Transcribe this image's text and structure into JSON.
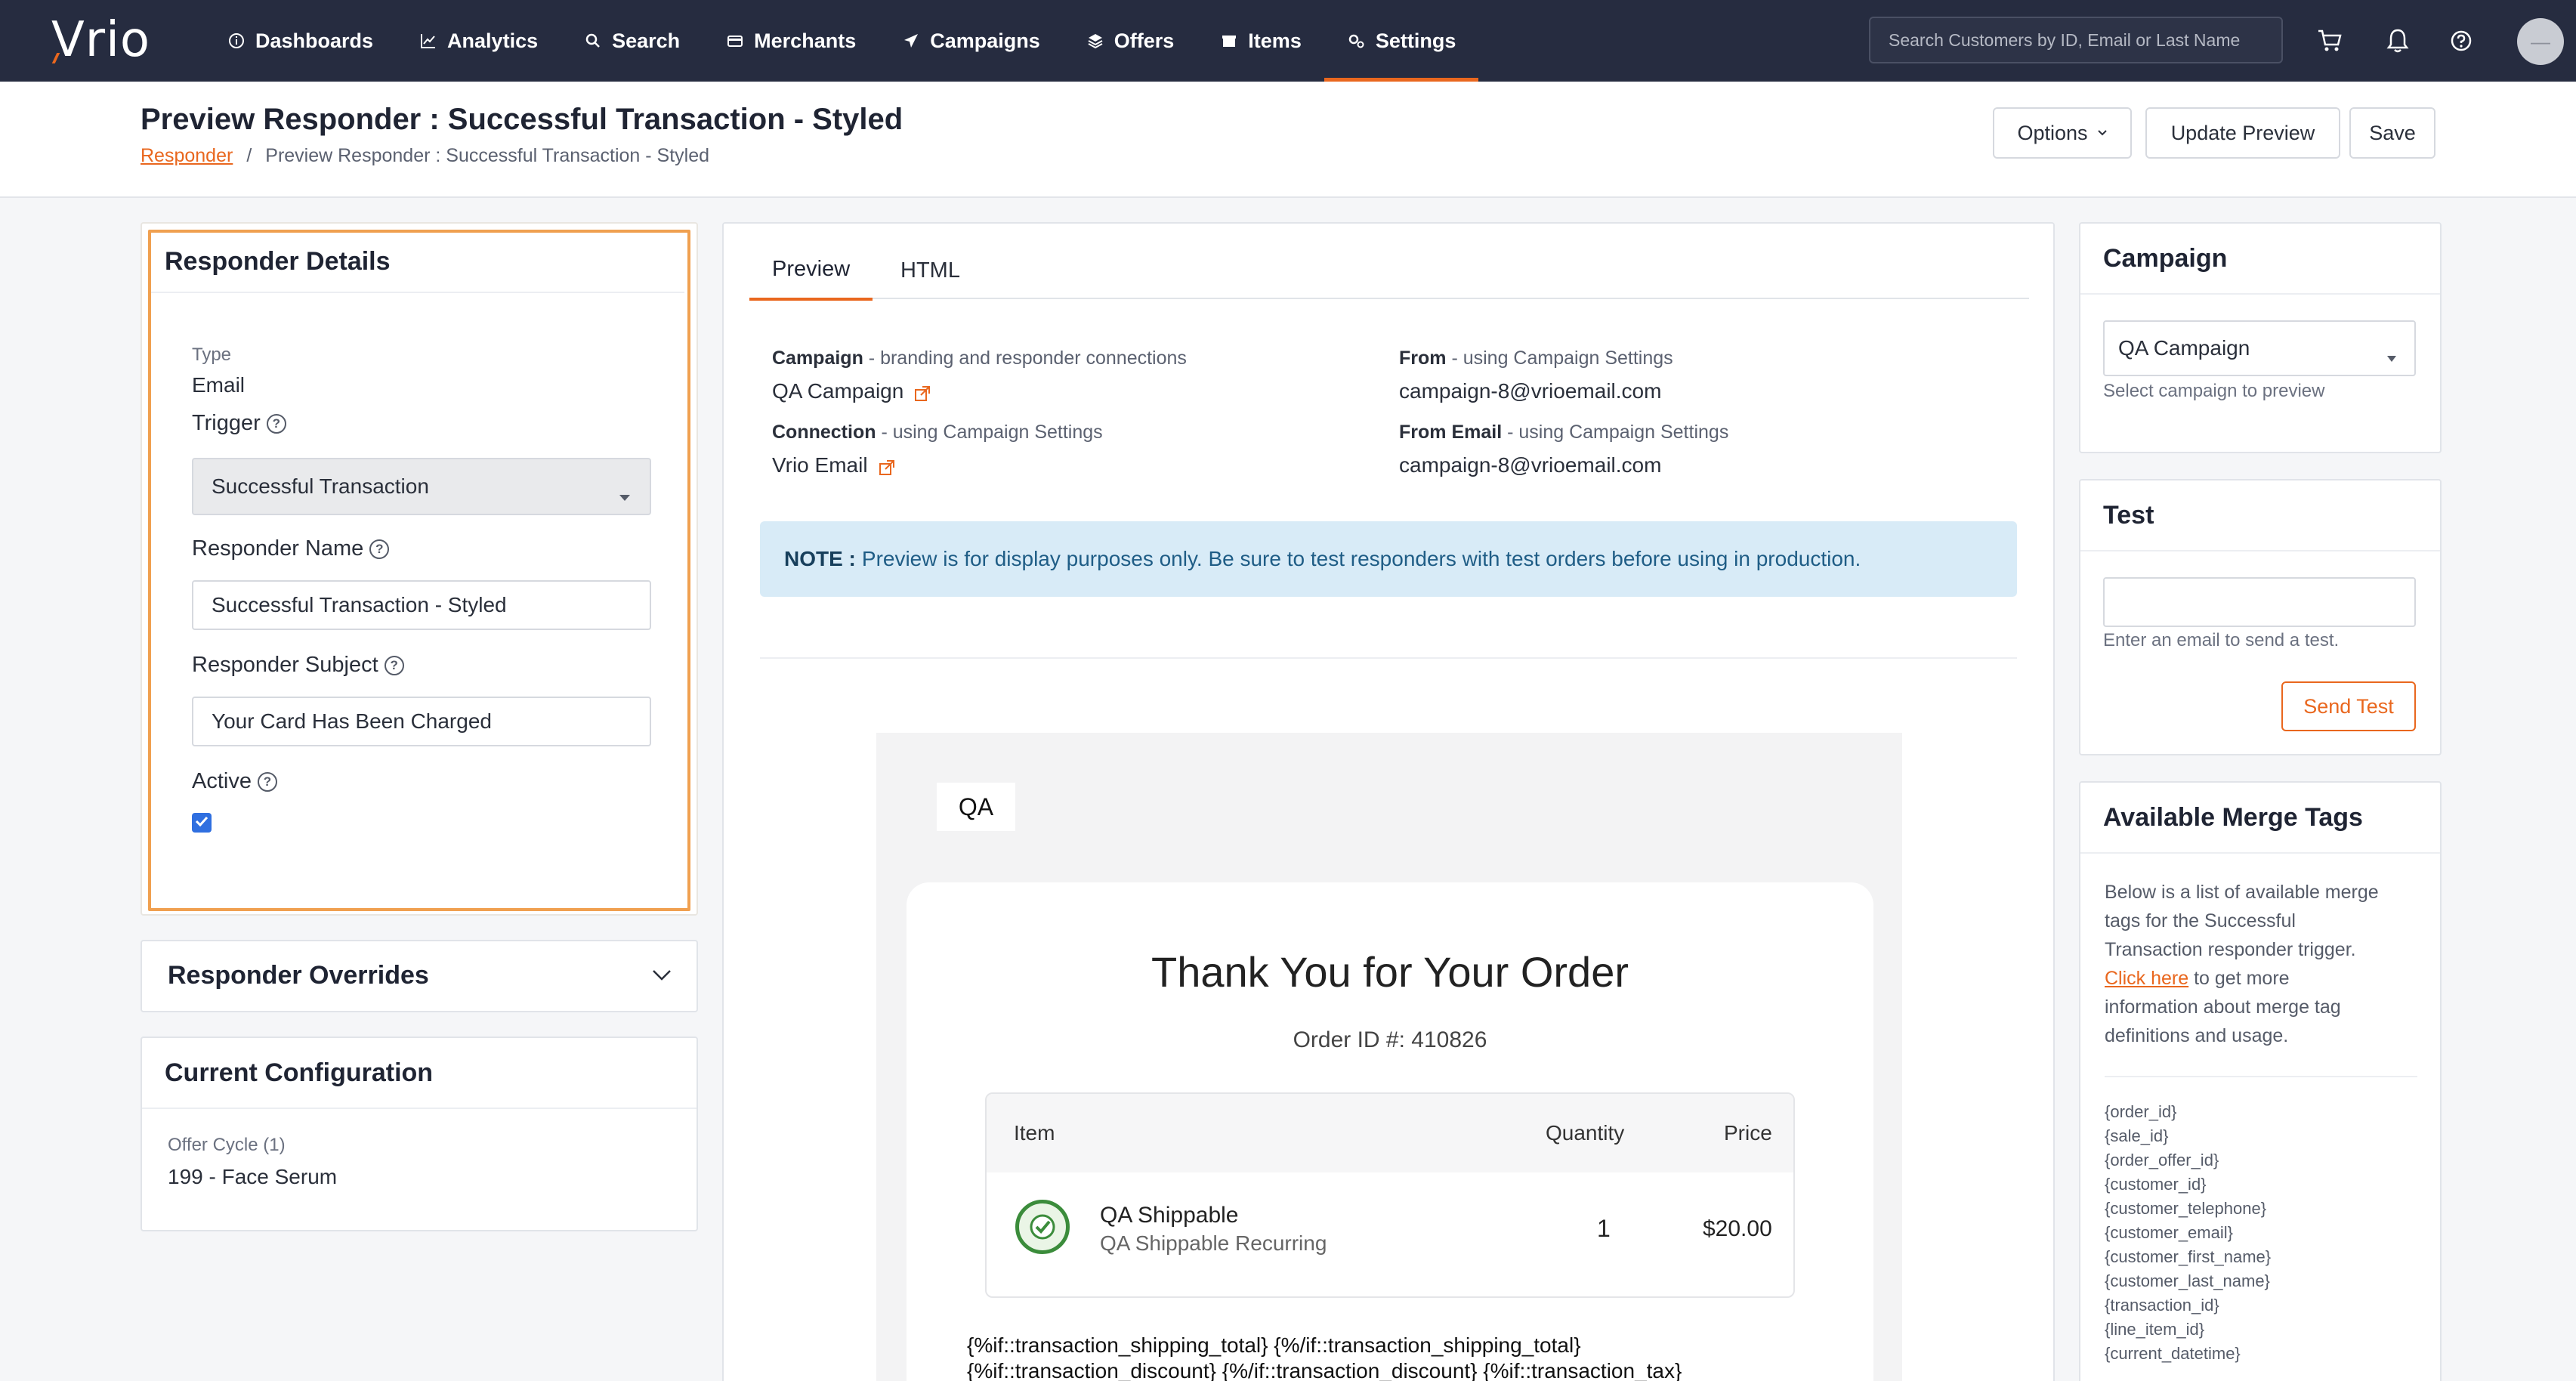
{
  "nav": {
    "brand": "Vrio",
    "items": [
      {
        "label": "Dashboards",
        "icon": "info-circle-icon"
      },
      {
        "label": "Analytics",
        "icon": "line-chart-icon"
      },
      {
        "label": "Search",
        "icon": "search-icon"
      },
      {
        "label": "Merchants",
        "icon": "card-icon"
      },
      {
        "label": "Campaigns",
        "icon": "paper-plane-icon"
      },
      {
        "label": "Offers",
        "icon": "layers-icon"
      },
      {
        "label": "Items",
        "icon": "box-icon"
      },
      {
        "label": "Settings",
        "icon": "gears-icon"
      }
    ],
    "active_item": "Settings",
    "search_placeholder": "Search Customers by ID, Email or Last Name",
    "accent": "#e9671e",
    "background": "#262c40"
  },
  "header": {
    "title": "Preview Responder : Successful Transaction - Styled",
    "breadcrumb": {
      "parent": "Responder",
      "separator": "/",
      "current": "Preview Responder : Successful Transaction - Styled"
    },
    "options_label": "Options",
    "update_label": "Update Preview",
    "save_label": "Save"
  },
  "details": {
    "title": "Responder Details",
    "type_label": "Type",
    "type_value": "Email",
    "trigger_label": "Trigger",
    "trigger_value": "Successful Transaction",
    "name_label": "Responder Name",
    "name_value": "Successful Transaction - Styled",
    "subject_label": "Responder Subject",
    "subject_value": "Your Card Has Been Charged",
    "active_label": "Active",
    "active_checked": true
  },
  "overrides": {
    "title": "Responder Overrides"
  },
  "config": {
    "title": "Current Configuration",
    "offer_label": "Offer Cycle (1)",
    "offer_value": "199 - Face Serum"
  },
  "preview": {
    "tabs": [
      "Preview",
      "HTML"
    ],
    "active_tab": "Preview",
    "campaign_label": "Campaign",
    "campaign_desc": " - branding and responder connections",
    "campaign_value": "QA Campaign",
    "connection_label": "Connection",
    "connection_desc": " - using Campaign Settings",
    "connection_value": "Vrio Email",
    "from_label": "From",
    "from_desc": " - using Campaign Settings",
    "from_value": "campaign-8@vrioemail.com",
    "from_email_label": "From Email",
    "from_email_desc": " - using Campaign Settings",
    "from_email_value": "campaign-8@vrioemail.com",
    "note_label": "NOTE :",
    "note_text": "Preview is for display purposes only. Be sure to test responders with test orders before using in production."
  },
  "email": {
    "logo_text": "QA",
    "heading": "Thank You for Your Order",
    "order_id": "Order ID #: 410826",
    "col_item": "Item",
    "col_quantity": "Quantity",
    "col_price": "Price",
    "item_name": "QA Shippable",
    "item_sub": "QA Shippable Recurring",
    "item_qty": "1",
    "item_price": "$20.00",
    "merge_line1": "{%if::transaction_shipping_total} {%/if::transaction_shipping_total}",
    "merge_line2": "{%if::transaction_discount} {%/if::transaction_discount} {%if::transaction_tax}"
  },
  "campaign_panel": {
    "title": "Campaign",
    "select_value": "QA Campaign",
    "hint": "Select campaign to preview"
  },
  "test_panel": {
    "title": "Test",
    "email_value": "",
    "hint": "Enter an email to send a test.",
    "send_label": "Send Test"
  },
  "merge_panel": {
    "title": "Available Merge Tags",
    "desc_1": "Below is a list of available merge",
    "desc_2": "tags for the Successful",
    "desc_3": "Transaction responder trigger.",
    "link": "Click here",
    "desc_4": " to get more",
    "desc_5": "information about merge tag",
    "desc_6": "definitions and usage.",
    "tags": [
      "{order_id}",
      "{sale_id}",
      "{order_offer_id}",
      "{customer_id}",
      "{customer_telephone}",
      "{customer_email}",
      "{customer_first_name}",
      "{customer_last_name}",
      "{transaction_id}",
      "{line_item_id}",
      "{current_datetime}"
    ]
  }
}
